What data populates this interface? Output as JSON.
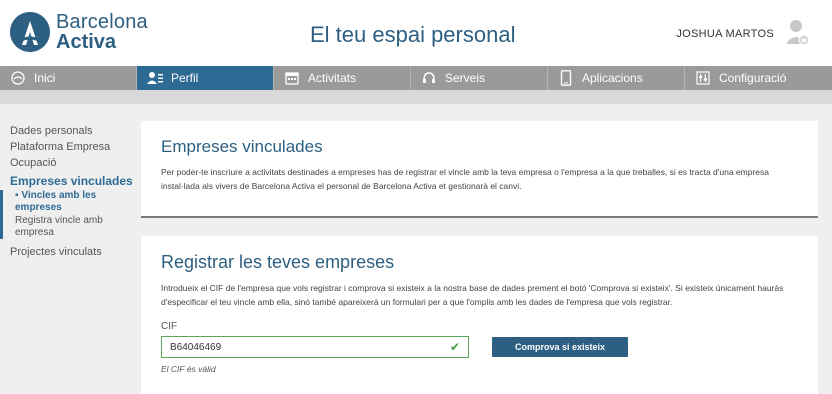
{
  "header": {
    "logo_line1": "Barcelona",
    "logo_line2": "Activa",
    "title": "El teu espai personal",
    "user_name": "JOSHUA MARTOS"
  },
  "nav": {
    "items": [
      {
        "label": "Inici",
        "icon": "home-icon"
      },
      {
        "label": "Perfil",
        "icon": "profile-icon",
        "active": true
      },
      {
        "label": "Activitats",
        "icon": "calendar-icon"
      },
      {
        "label": "Serveis",
        "icon": "headset-icon"
      },
      {
        "label": "Aplicacions",
        "icon": "mobile-icon"
      },
      {
        "label": "Configuració",
        "icon": "sliders-icon"
      }
    ]
  },
  "sidebar": {
    "items": [
      "Dades personals",
      "Plataforma Empresa",
      "Ocupació"
    ],
    "active": "Empreses vinculades",
    "sub_active": "▪ Vincles amb les empreses",
    "sub_other": "Registra vincle amb empresa",
    "last": "Projectes vinculats"
  },
  "card1": {
    "title": "Empreses vinculades",
    "text": "Per poder-te inscriure a activitats destinades a empreses has de registrar el vincle amb la teva empresa o l'empresa a la que treballes, si es tracta d'una empresa instal·lada als vivers de Barcelona Activa el personal de Barcelona Activa et gestionarà el canvi."
  },
  "card2": {
    "title": "Registrar les teves empreses",
    "text": "Introdueix el CIF de l'empresa que vols registrar i comprova si existeix a la nostra base de dades prement el botó 'Comprova si existeix'. Si existeix únicament hauràs d'especificar el teu vincle amb ella, sinó també apareixerà un formulari per a que l'omplis amb les dades de l'empresa que vols registrar.",
    "cif_label": "CIF",
    "cif_value": "B64046469",
    "button_label": "Comprova si existeix",
    "valid_text": "El CIF és vàlid"
  },
  "colors": {
    "brand": "#2d5f82",
    "nav_active": "#2d6a94",
    "nav_bg": "#9a9a9a",
    "valid_green": "#4a9c43"
  }
}
